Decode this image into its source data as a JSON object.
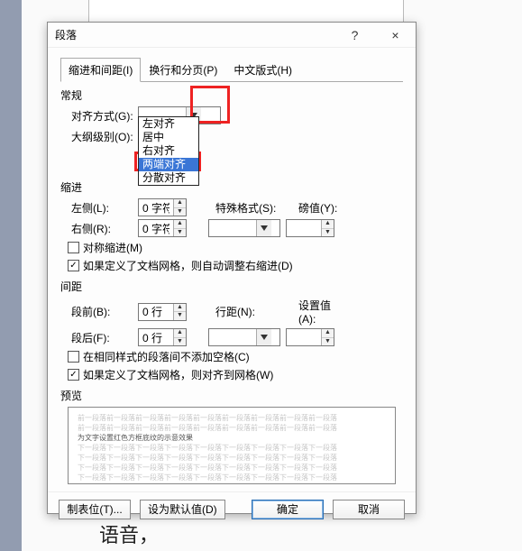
{
  "bg_text": "语音，",
  "dialog": {
    "title": "段落",
    "help": "?",
    "close": "×",
    "tabs": [
      "缩进和间距(I)",
      "换行和分页(P)",
      "中文版式(H)"
    ],
    "general": {
      "head": "常规",
      "align_label": "对齐方式(G):",
      "align_value": "",
      "outline_label": "大纲级别(O):",
      "align_options": [
        "左对齐",
        "居中",
        "右对齐",
        "两端对齐",
        "分散对齐"
      ]
    },
    "indent": {
      "head": "缩进",
      "left_label": "左侧(L):",
      "left_value": "0 字符",
      "right_label": "右侧(R):",
      "right_value": "0 字符",
      "special_label": "特殊格式(S):",
      "by_label": "磅值(Y):",
      "mirror_cb": "对称缩进(M)",
      "grid_cb": "如果定义了文档网格，则自动调整右缩进(D)"
    },
    "spacing": {
      "head": "间距",
      "before_label": "段前(B):",
      "before_value": "0 行",
      "after_label": "段后(F):",
      "after_value": "0 行",
      "line_label": "行距(N):",
      "at_label": "设置值(A):",
      "same_cb": "在相同样式的段落间不添加空格(C)",
      "grid_cb": "如果定义了文档网格，则对齐到网格(W)"
    },
    "preview": {
      "head": "预览",
      "ghost": "前一段落前一段落前一段落前一段落前一段落前一段落前一段落前一段落前一段落",
      "sample": "为文字设置红色方框底纹的示意效果",
      "ghost2": "下一段落下一段落下一段落下一段落下一段落下一段落下一段落下一段落下一段落"
    },
    "buttons": {
      "tabs": "制表位(T)...",
      "default": "设为默认值(D)",
      "ok": "确定",
      "cancel": "取消"
    }
  }
}
